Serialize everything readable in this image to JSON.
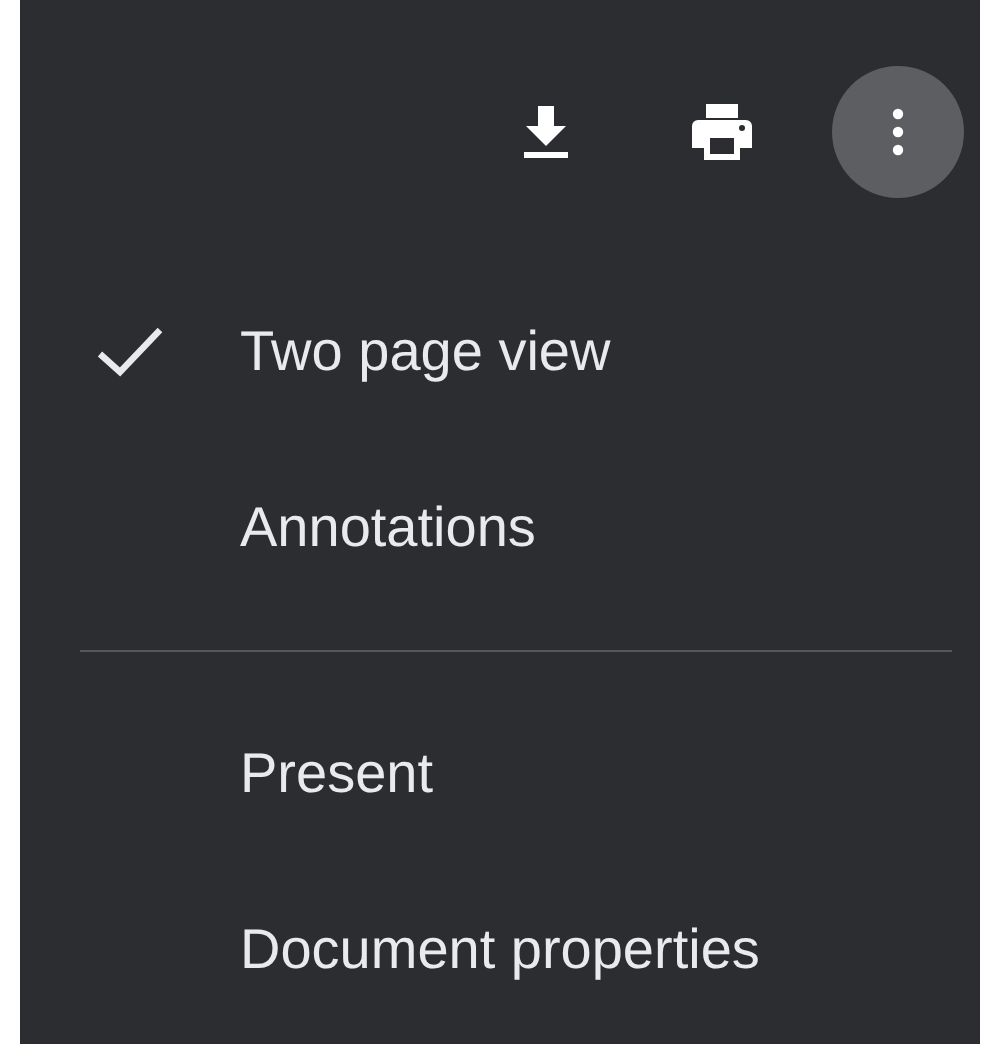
{
  "toolbar": {
    "buttons": [
      {
        "kind": "download",
        "pressed": false
      },
      {
        "kind": "print",
        "pressed": false
      },
      {
        "kind": "more",
        "pressed": true
      }
    ]
  },
  "menu": {
    "sections": [
      {
        "items": [
          {
            "label": "Two page view",
            "checked": true
          },
          {
            "label": "Annotations",
            "checked": false
          }
        ]
      },
      {
        "items": [
          {
            "label": "Present",
            "checked": false
          },
          {
            "label": "Document properties",
            "checked": false
          }
        ]
      }
    ]
  }
}
